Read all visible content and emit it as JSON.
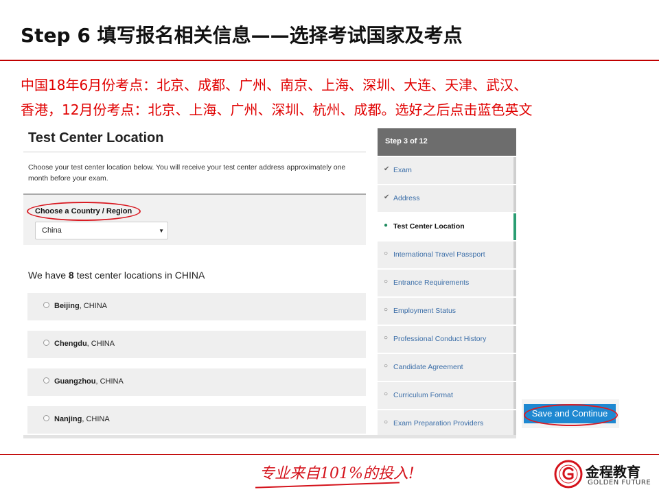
{
  "slide": {
    "title": "Step 6 填写报名相关信息——选择考试国家及考点",
    "note_line1": "中国18年6月份考点：北京、成都、广州、南京、上海、深圳、大连、天津、武汉、",
    "note_line2": "香港，12月份考点：北京、上海、广州、深圳、杭州、成都。选好之后点击蓝色英文"
  },
  "form": {
    "title": "Test Center Location",
    "intro": "Choose your test center location below. You will receive your test center address approximately one month before your exam.",
    "country_label": "Choose a Country / Region",
    "country_value": "China",
    "count_prefix": "We have",
    "count_number": "8",
    "count_suffix": "test center locations in CHINA",
    "locations": [
      {
        "city": "Beijing",
        "country": ", CHINA"
      },
      {
        "city": "Chengdu",
        "country": ", CHINA"
      },
      {
        "city": "Guangzhou",
        "country": ", CHINA"
      },
      {
        "city": "Nanjing",
        "country": ", CHINA"
      }
    ]
  },
  "steps": {
    "header": "Step 3 of 12",
    "items": [
      {
        "label": "Exam",
        "mark": "✔"
      },
      {
        "label": "Address",
        "mark": "✔"
      },
      {
        "label": "Test Center Location",
        "mark": "●"
      },
      {
        "label": "International Travel Passport",
        "mark": "○"
      },
      {
        "label": "Entrance Requirements",
        "mark": "○"
      },
      {
        "label": "Employment Status",
        "mark": "○"
      },
      {
        "label": "Professional Conduct History",
        "mark": "○"
      },
      {
        "label": "Candidate Agreement",
        "mark": "○"
      },
      {
        "label": "Curriculum Format",
        "mark": "○"
      },
      {
        "label": "Exam Preparation Providers",
        "mark": "○"
      }
    ],
    "save_label": "Save and Continue"
  },
  "footer": {
    "slogan": "专业来自101%的投入!",
    "brand_cn": "金程教育",
    "brand_en": "GOLDEN FUTURE"
  },
  "colors": {
    "accent_red": "#d91c24",
    "button_blue": "#1e88d1",
    "active_step_green": "#2a9d72"
  }
}
